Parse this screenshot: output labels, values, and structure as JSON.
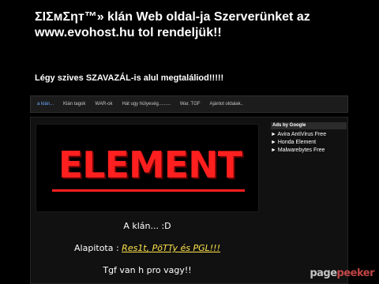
{
  "header": {
    "title": "ΣΙΣмΣηт™» klán Web oldal-ja Szerverünket az www.evohost.hu tol rendeljük!!",
    "subtitle": "Légy szives SZAVAZÁL-is alul megtaláliod!!!!!"
  },
  "nav": {
    "items": [
      {
        "label": "a klán..."
      },
      {
        "label": "Klán tagok"
      },
      {
        "label": "WAR-ok"
      },
      {
        "label": "Hát ugy hülyeség........."
      },
      {
        "label": "War. TGF"
      },
      {
        "label": "Ajánlot oldalak.."
      }
    ]
  },
  "banner": {
    "logo_text": "ELEMENT"
  },
  "content": {
    "line1": "A klán...  :D",
    "line2_prefix": "Alapitota : ",
    "line2_names": "Res1t, PöTTy és PGL!!!",
    "line3": "Tgf van h pro vagy!!"
  },
  "ads": {
    "header": "Ads by Google",
    "links": [
      {
        "label": "► Avira AntiVirus Free"
      },
      {
        "label": "► Honda Element"
      },
      {
        "label": "► Malwarebytes Free"
      }
    ]
  },
  "watermark": {
    "part1": "page",
    "part2": "peeker"
  },
  "colors": {
    "accent_red": "#ff1f1f",
    "names_yellow": "#ffe44d",
    "nav_active": "#6fa8ff"
  }
}
